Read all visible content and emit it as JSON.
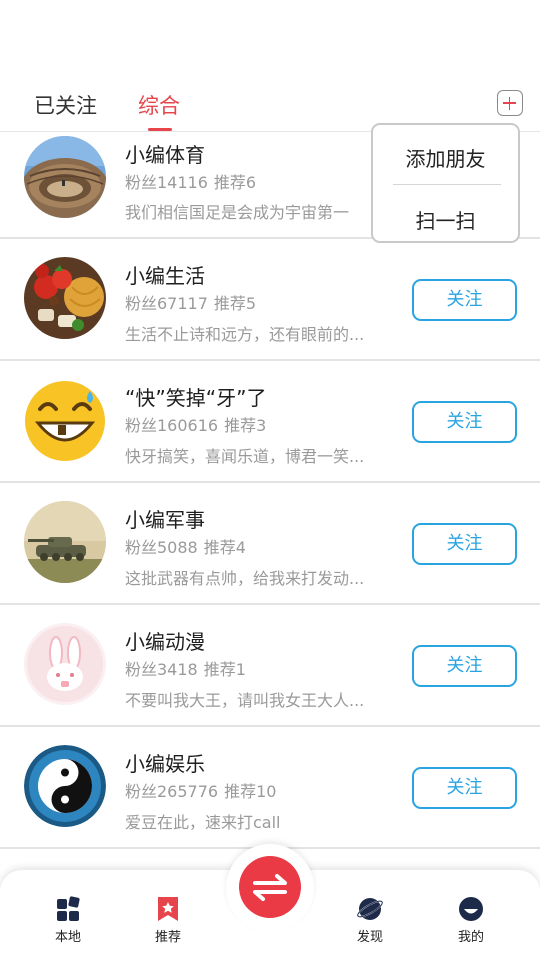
{
  "tabs": {
    "followed": "已关注",
    "overall": "综合",
    "active": "综合",
    "add_icon": "plus-icon"
  },
  "popup": {
    "add_friend": "添加朋友",
    "scan": "扫一扫"
  },
  "list": [
    {
      "name": "小编体育",
      "fans": "粉丝14116",
      "rec": "推荐6",
      "desc": "我们相信国足是会成为宇宙第一",
      "follow": "",
      "avatar": "stadium"
    },
    {
      "name": "小编生活",
      "fans": "粉丝67117",
      "rec": "推荐5",
      "desc": "生活不止诗和远方，还有眼前的...",
      "follow": "关注",
      "avatar": "food"
    },
    {
      "name": "“快”笑掉“牙”了",
      "fans": "粉丝160616",
      "rec": "推荐3",
      "desc": "快牙搞笑，喜闻乐道，博君一笑...",
      "follow": "关注",
      "avatar": "emoji-laugh"
    },
    {
      "name": "小编军事",
      "fans": "粉丝5088",
      "rec": "推荐4",
      "desc": "这批武器有点帅，给我来打发动...",
      "follow": "关注",
      "avatar": "tank"
    },
    {
      "name": "小编动漫",
      "fans": "粉丝3418",
      "rec": "推荐1",
      "desc": "不要叫我大王，请叫我女王大人...",
      "follow": "关注",
      "avatar": "bunny"
    },
    {
      "name": "小编娱乐",
      "fans": "粉丝265776",
      "rec": "推荐10",
      "desc": "爱豆在此，速来打call",
      "follow": "关注",
      "avatar": "yin-yang"
    }
  ],
  "bottom_nav": {
    "local": "本地",
    "recommend": "推荐",
    "discover": "发现",
    "mine": "我的"
  },
  "colors": {
    "accent": "#e5454b",
    "follow_blue": "#2aa4e0",
    "fab_red": "#ea3a45"
  }
}
